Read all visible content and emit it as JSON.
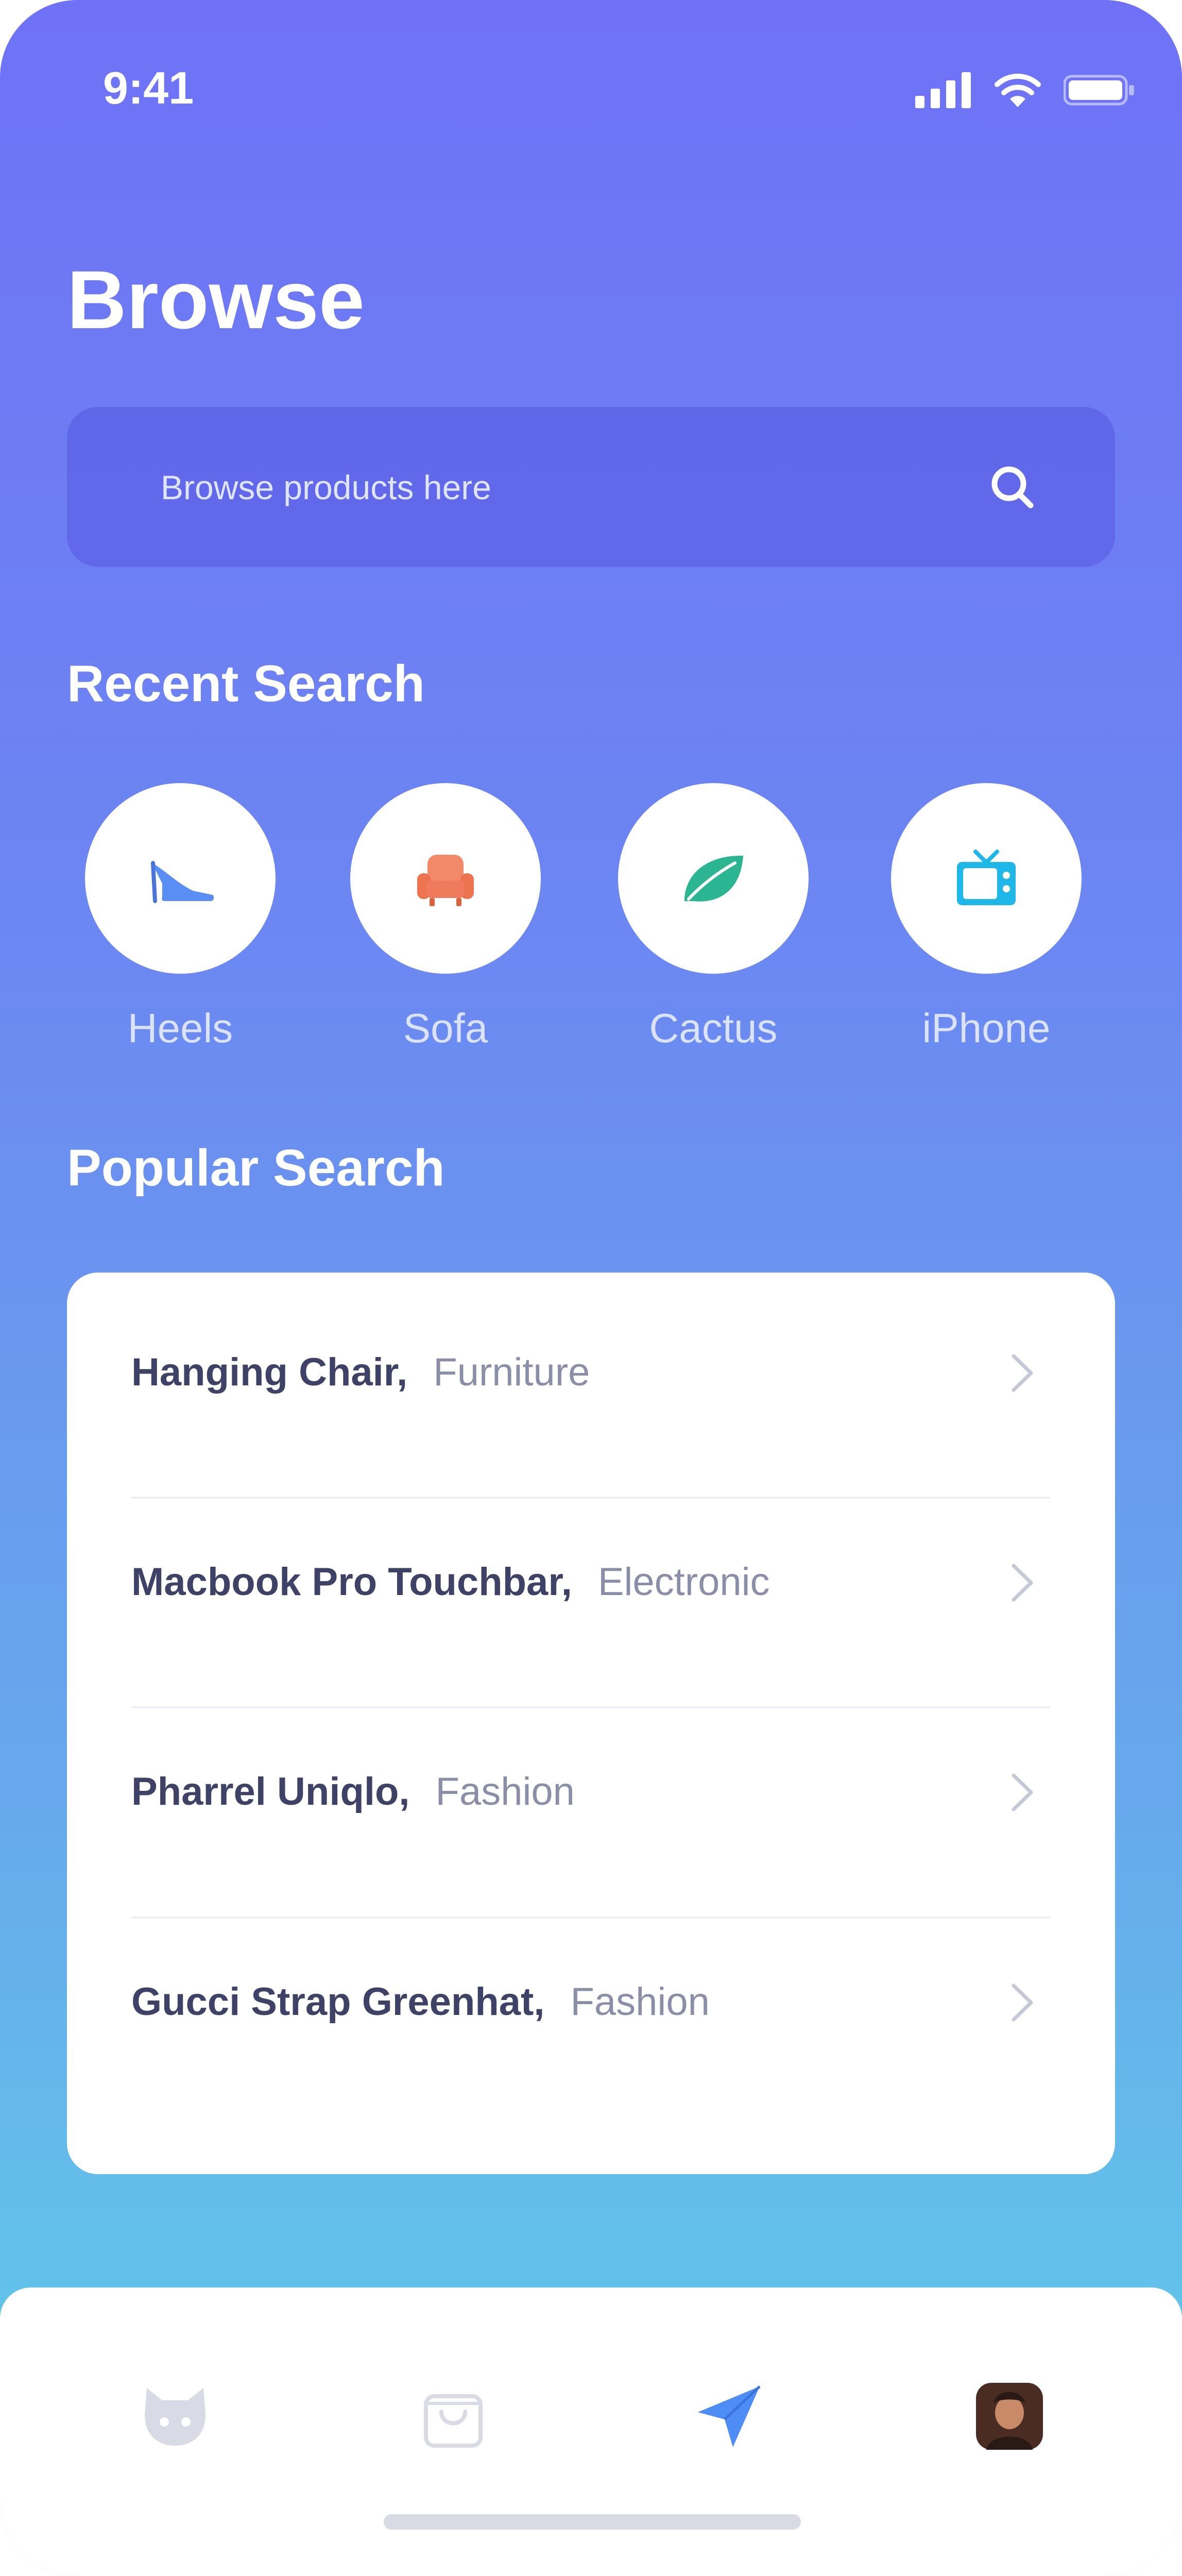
{
  "status_bar": {
    "time": "9:41",
    "icons": [
      "signal-icon",
      "wifi-icon",
      "battery-icon"
    ]
  },
  "page": {
    "title": "Browse"
  },
  "search": {
    "placeholder": "Browse products here",
    "icon": "search-icon"
  },
  "recent_search": {
    "title": "Recent Search",
    "items": [
      {
        "label": "Heels",
        "icon": "heels-icon",
        "color": "#5b8ef5"
      },
      {
        "label": "Sofa",
        "icon": "sofa-icon",
        "color": "#f07a5c"
      },
      {
        "label": "Cactus",
        "icon": "leaf-icon",
        "color": "#2bb592"
      },
      {
        "label": "iPhone",
        "icon": "tv-icon",
        "color": "#1fb6e8"
      }
    ]
  },
  "popular_search": {
    "title": "Popular Search",
    "items": [
      {
        "name": "Hanging Chair",
        "category": "Furniture"
      },
      {
        "name": "Macbook Pro Touchbar",
        "category": "Electronic"
      },
      {
        "name": "Pharrel Uniqlo",
        "category": "Fashion"
      },
      {
        "name": "Gucci Strap Greenhat",
        "category": "Fashion"
      }
    ],
    "separator": ","
  },
  "bottom_nav": {
    "items": [
      {
        "icon": "octocat-icon",
        "active": false
      },
      {
        "icon": "shopping-bag-icon",
        "active": false
      },
      {
        "icon": "send-icon",
        "active": true
      },
      {
        "icon": "profile-avatar",
        "active": false
      }
    ],
    "active_color": "#4d8df5",
    "inactive_color": "#d8dbe5"
  },
  "colors": {
    "gradient_top": "#6f72f6",
    "gradient_bottom": "#5fd0e8",
    "text_dark": "#3d4266",
    "text_muted": "#8a8ea8"
  }
}
